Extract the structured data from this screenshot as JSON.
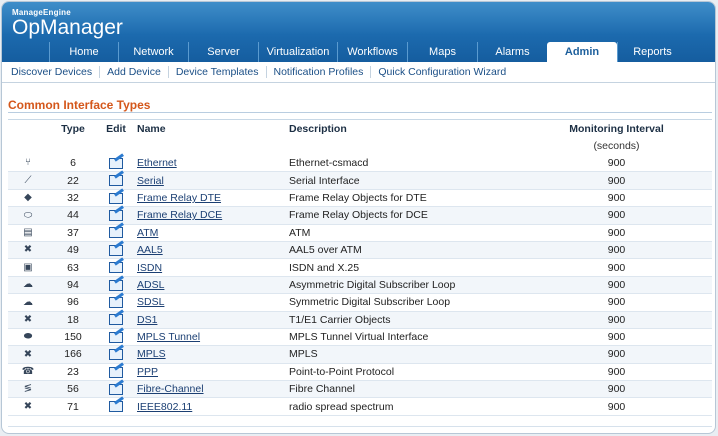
{
  "app": {
    "brand": "ManageEngine",
    "product": "OpManager"
  },
  "nav": [
    {
      "label": "Home",
      "w": 69
    },
    {
      "label": "Network",
      "w": 70
    },
    {
      "label": "Server",
      "w": 70
    },
    {
      "label": "Virtualization",
      "w": 79
    },
    {
      "label": "Workflows",
      "w": 70
    },
    {
      "label": "Maps",
      "w": 70
    },
    {
      "label": "Alarms",
      "w": 70
    },
    {
      "label": "Admin",
      "w": 70,
      "active": true
    },
    {
      "label": "Reports",
      "w": 70
    }
  ],
  "subnav": [
    "Discover Devices",
    "Add Device",
    "Device Templates",
    "Notification Profiles",
    "Quick Configuration Wizard"
  ],
  "section": {
    "title": "Common Interface Types"
  },
  "table": {
    "headers": {
      "type": "Type",
      "edit": "Edit",
      "name": "Name",
      "description": "Description",
      "monitoring": "Monitoring Interval",
      "unit": "(seconds)"
    },
    "rows": [
      {
        "icon": "⑂",
        "icon_name": "ethernet-icon",
        "type": "6",
        "name": "Ethernet",
        "description": "Ethernet-csmacd",
        "interval": "900"
      },
      {
        "icon": "⟋",
        "icon_name": "serial-icon",
        "type": "22",
        "name": "Serial",
        "description": "Serial Interface",
        "interval": "900"
      },
      {
        "icon": "◆",
        "icon_name": "frame-relay-dte-icon",
        "type": "32",
        "name": "Frame Relay DTE",
        "description": "Frame Relay Objects for DTE",
        "interval": "900"
      },
      {
        "icon": "⬭",
        "icon_name": "frame-relay-dce-icon",
        "type": "44",
        "name": "Frame Relay DCE",
        "description": "Frame Relay Objects for DCE",
        "interval": "900"
      },
      {
        "icon": "▤",
        "icon_name": "atm-icon",
        "type": "37",
        "name": "ATM",
        "description": "ATM",
        "interval": "900"
      },
      {
        "icon": "✖",
        "icon_name": "aal5-icon",
        "type": "49",
        "name": "AAL5",
        "description": "AAL5 over ATM",
        "interval": "900"
      },
      {
        "icon": "▣",
        "icon_name": "isdn-icon",
        "type": "63",
        "name": "ISDN",
        "description": "ISDN and X.25",
        "interval": "900"
      },
      {
        "icon": "☁",
        "icon_name": "adsl-icon",
        "type": "94",
        "name": "ADSL",
        "description": "Asymmetric Digital Subscriber Loop",
        "interval": "900"
      },
      {
        "icon": "☁",
        "icon_name": "sdsl-icon",
        "type": "96",
        "name": "SDSL",
        "description": "Symmetric Digital Subscriber Loop",
        "interval": "900"
      },
      {
        "icon": "✖",
        "icon_name": "ds1-icon",
        "type": "18",
        "name": "DS1",
        "description": "T1/E1 Carrier Objects",
        "interval": "900"
      },
      {
        "icon": "⬬",
        "icon_name": "mpls-tunnel-icon",
        "type": "150",
        "name": "MPLS Tunnel",
        "description": "MPLS Tunnel Virtual Interface",
        "interval": "900"
      },
      {
        "icon": "✖",
        "icon_name": "mpls-icon",
        "type": "166",
        "name": "MPLS",
        "description": "MPLS",
        "interval": "900"
      },
      {
        "icon": "☎",
        "icon_name": "ppp-icon",
        "type": "23",
        "name": "PPP",
        "description": "Point-to-Point Protocol",
        "interval": "900"
      },
      {
        "icon": "≶",
        "icon_name": "fibre-channel-icon",
        "type": "56",
        "name": "Fibre-Channel",
        "description": "Fibre Channel",
        "interval": "900"
      },
      {
        "icon": "✖",
        "icon_name": "ieee80211-icon",
        "type": "71",
        "name": "IEEE802.11",
        "description": "radio spread spectrum",
        "interval": "900"
      }
    ]
  }
}
